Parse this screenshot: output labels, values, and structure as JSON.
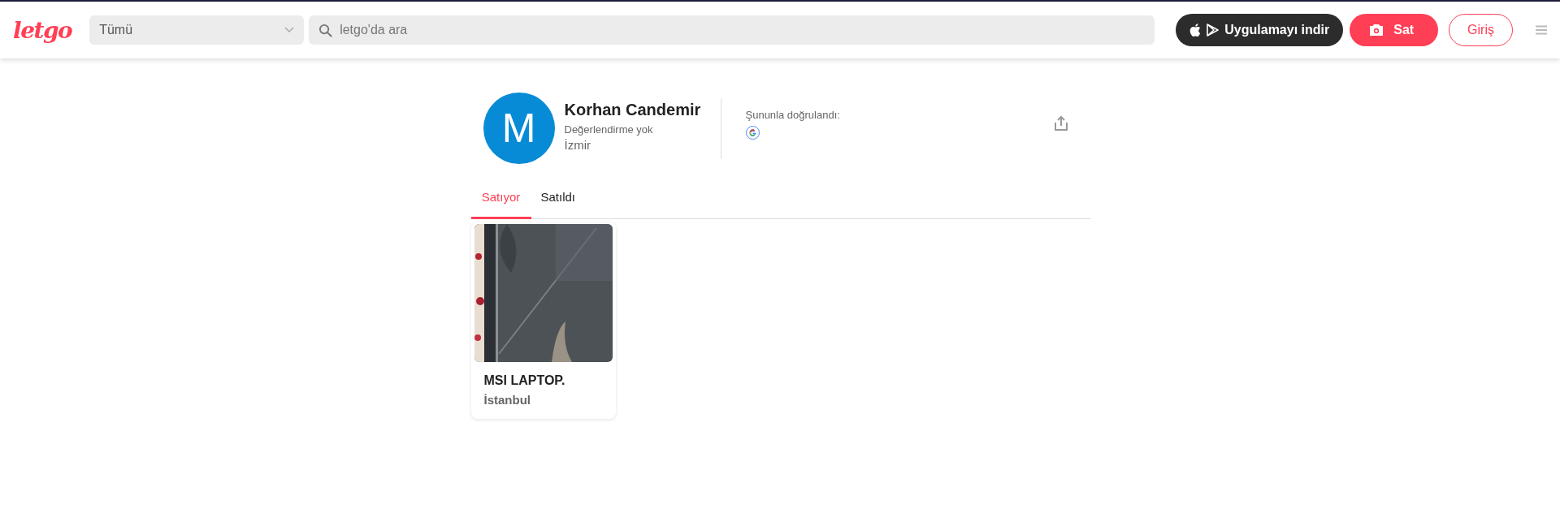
{
  "header": {
    "logo": "letgo",
    "category": {
      "value": "Tümü"
    },
    "search": {
      "placeholder": "letgo'da ara"
    },
    "app_button": "Uygulamayı indir",
    "sell_button": "Sat",
    "login_button": "Giriş"
  },
  "profile": {
    "avatar_letter": "M",
    "name": "Korhan Candemir",
    "rating": "Değerlendirme yok",
    "city": "İzmir",
    "verified_label": "Şununla doğrulandı:"
  },
  "tabs": [
    {
      "label": "Satıyor",
      "selected": true
    },
    {
      "label": "Satıldı",
      "selected": false
    }
  ],
  "listings": [
    {
      "kind": "picture",
      "title": "MSI LAPTOP.",
      "city": "İstanbul"
    }
  ]
}
